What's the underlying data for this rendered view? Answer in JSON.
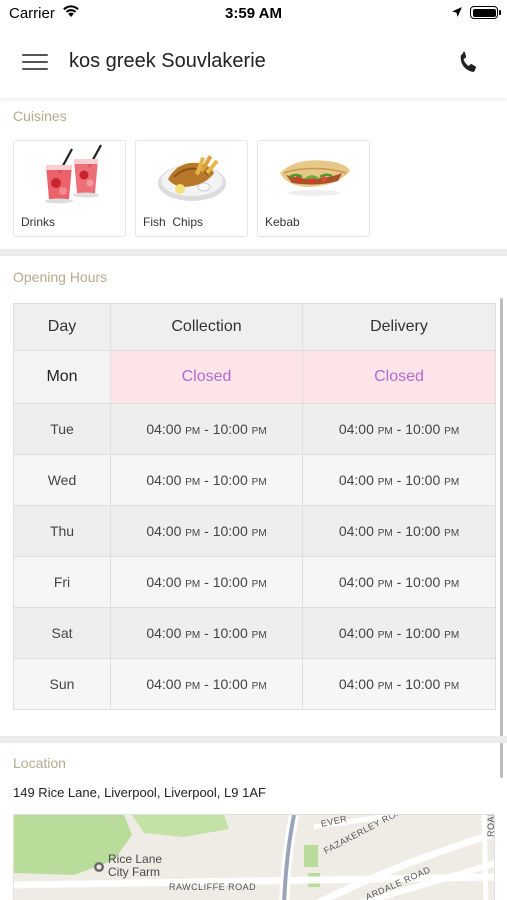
{
  "status_bar": {
    "carrier": "Carrier",
    "time": "3:59 AM"
  },
  "nav": {
    "title": "kos greek Souvlakerie",
    "menu_icon": "hamburger-menu-icon",
    "phone_icon": "phone-icon"
  },
  "cuisines": {
    "label": "Cuisines",
    "items": [
      {
        "label": "Drinks",
        "icon": "drinks-image"
      },
      {
        "label": "Fish  Chips",
        "icon": "fish-chips-image"
      },
      {
        "label": "Kebab",
        "icon": "kebab-image"
      }
    ]
  },
  "opening_hours": {
    "label": "Opening Hours",
    "headers": [
      "Day",
      "Collection",
      "Delivery"
    ],
    "rows": [
      {
        "day": "Mon",
        "collection": "Closed",
        "delivery": "Closed"
      },
      {
        "day": "Tue",
        "collection_open": "04:00",
        "collection_close": "10:00",
        "delivery_open": "04:00",
        "delivery_close": "10:00"
      },
      {
        "day": "Wed",
        "collection_open": "04:00",
        "collection_close": "10:00",
        "delivery_open": "04:00",
        "delivery_close": "10:00"
      },
      {
        "day": "Thu",
        "collection_open": "04:00",
        "collection_close": "10:00",
        "delivery_open": "04:00",
        "delivery_close": "10:00"
      },
      {
        "day": "Fri",
        "collection_open": "04:00",
        "collection_close": "10:00",
        "delivery_open": "04:00",
        "delivery_close": "10:00"
      },
      {
        "day": "Sat",
        "collection_open": "04:00",
        "collection_close": "10:00",
        "delivery_open": "04:00",
        "delivery_close": "10:00"
      },
      {
        "day": "Sun",
        "collection_open": "04:00",
        "collection_close": "10:00",
        "delivery_open": "04:00",
        "delivery_close": "10:00"
      }
    ],
    "am_pm": "PM",
    "separator": "-",
    "closed_color": "#b16ccf"
  },
  "location": {
    "label": "Location",
    "address": "149 Rice Lane, Liverpool, Liverpool, L9 1AF",
    "map_labels": {
      "farm": "Rice Lane\nCity Farm",
      "rawcliffe": "RAWCLIFFE ROAD",
      "fazakerley": "FAZAKERLEY ROAD",
      "ardale": "ARDALE ROAD",
      "ever": "EVER",
      "road": "ROAD"
    }
  },
  "colors": {
    "section_label": "#b8a98c",
    "closed_row_bg": "#fde4e8"
  }
}
